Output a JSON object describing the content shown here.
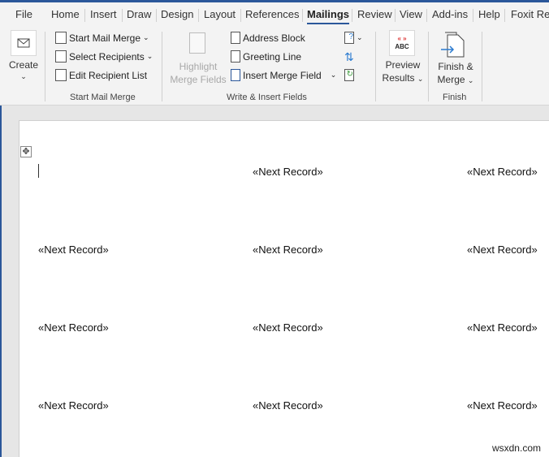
{
  "tabs": [
    "File",
    "Home",
    "Insert",
    "Draw",
    "Design",
    "Layout",
    "References",
    "Mailings",
    "Review",
    "View",
    "Add-ins",
    "Help",
    "Foxit Re"
  ],
  "active_tab": "Mailings",
  "ribbon": {
    "create": {
      "label": "Create"
    },
    "start_group": {
      "label": "Start Mail Merge",
      "items": [
        "Start Mail Merge",
        "Select Recipients",
        "Edit Recipient List"
      ]
    },
    "write_group": {
      "label": "Write & Insert Fields",
      "highlight_line1": "Highlight",
      "highlight_line2": "Merge Fields",
      "items": [
        "Address Block",
        "Greeting Line",
        "Insert Merge Field"
      ]
    },
    "preview": {
      "icon_text": "ABC",
      "line1": "Preview",
      "line2": "Results"
    },
    "finish": {
      "line1": "Finish &",
      "line2": "Merge",
      "group_label": "Finish"
    }
  },
  "document": {
    "records": [
      [
        "",
        "«Next Record»",
        "«Next Record»"
      ],
      [
        "«Next Record»",
        "«Next Record»",
        "«Next Record»"
      ],
      [
        "«Next Record»",
        "«Next Record»",
        "«Next Record»"
      ],
      [
        "«Next Record»",
        "«Next Record»",
        "«Next Record»"
      ]
    ]
  },
  "watermark": "wsxdn.com"
}
